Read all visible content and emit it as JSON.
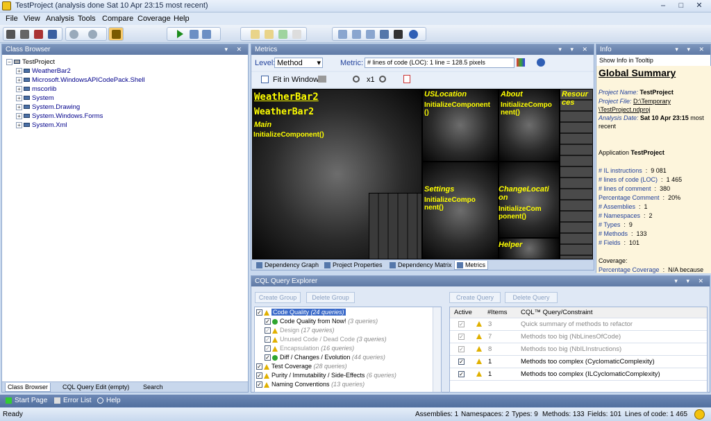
{
  "window": {
    "title": "TestProject  (analysis done Sat 10 Apr  23:15 most recent)",
    "minimize": "–",
    "maximize": "□",
    "close": "✕"
  },
  "menu": [
    "File",
    "View",
    "Analysis",
    "Tools",
    "Compare",
    "Coverage",
    "Help"
  ],
  "class_browser": {
    "title": "Class Browser",
    "root": "TestProject",
    "items": [
      "WeatherBar2",
      "Microsoft.WindowsAPICodePack.Shell",
      "mscorlib",
      "System",
      "System.Drawing",
      "System.Windows.Forms",
      "System.Xml"
    ],
    "tabs": [
      "Class Browser",
      "CQL Query Edit (empty)",
      "Search"
    ]
  },
  "metrics": {
    "title": "Metrics",
    "level_label": "Level:",
    "level_value": "Method",
    "metric_label": "Metric:",
    "metric_value": "# lines of code (LOC):  1 line = 128.5 pixels",
    "fit_label": "Fit in Window",
    "zoom_label": "x1",
    "labels": {
      "weatherbar_a": "WeatherBar2",
      "weatherbar_b": "WeatherBar2",
      "main": "Main",
      "main_m": "InitializeComponent()",
      "uslocation": "USLocation",
      "uslocation_m": "InitializeComponent ()",
      "about": "About",
      "about_m": "InitializeCompo nent()",
      "resources": "Resour ces",
      "settings": "Settings",
      "settings_m": "InitializeCompo nent()",
      "changeloc": "ChangeLocati on",
      "changeloc_m": "InitializeCom ponent()",
      "helper": "Helper"
    },
    "tabs": [
      "Dependency Graph",
      "Project Properties",
      "Dependency Matrix",
      "Metrics"
    ]
  },
  "info": {
    "title": "Info",
    "tooltip_label": "Show Info in Tooltip",
    "heading": "Global Summary",
    "project_name_label": "Project Name:",
    "project_name": "TestProject",
    "project_file_label": "Project File:",
    "project_file_1": "D:\\Temporary",
    "project_file_2": "\\TestProject.ndproj",
    "analysis_date_label": "Analysis Date:",
    "analysis_date": "Sat 10 Apr  23:15",
    "analysis_date_suffix": "most",
    "analysis_date_suffix2": "recent",
    "application_label": "Application",
    "application_name": "TestProject",
    "stats": [
      {
        "label": "# IL instructions",
        "value": "9 081"
      },
      {
        "label": "# lines of code (LOC)",
        "value": "1 465"
      },
      {
        "label": "# lines of comment",
        "value": "380"
      },
      {
        "label": "Percentage Comment",
        "value": "20%"
      },
      {
        "label": "# Assemblies",
        "value": "1"
      },
      {
        "label": "# Namespaces",
        "value": "2"
      },
      {
        "label": "# Types",
        "value": "9"
      },
      {
        "label": "# Methods",
        "value": "133"
      },
      {
        "label": "# Fields",
        "value": "101"
      }
    ],
    "coverage_label": "Coverage:",
    "coverage_line": "Percentage Coverage",
    "coverage_value": "N/A because"
  },
  "cql": {
    "title": "CQL Query Explorer",
    "buttons": {
      "create_group": "Create Group",
      "delete_group": "Delete Group",
      "create_query": "Create Query",
      "delete_query": "Delete Query"
    },
    "groups": [
      {
        "name": "Code Quality",
        "count": "(24 queries)"
      },
      {
        "name": "Code Quality from Now!",
        "count": "(3 queries)"
      },
      {
        "name": "Design",
        "count": "(17 queries)"
      },
      {
        "name": "Unused Code / Dead Code",
        "count": "(3 queries)"
      },
      {
        "name": "Encapsulation",
        "count": "(16 queries)"
      },
      {
        "name": "Diff / Changes / Evolution",
        "count": "(44 queries)"
      },
      {
        "name": "Test Coverage",
        "count": "(28 queries)"
      },
      {
        "name": "Purity / Immutability / Side-Effects",
        "count": "(6 queries)"
      },
      {
        "name": "Naming Conventions",
        "count": "(13 queries)"
      }
    ],
    "grid_headers": [
      "Active",
      "#Items",
      "CQL™ Query/Constraint"
    ],
    "rows": [
      {
        "items": "3",
        "query": "Quick summary of methods to refactor"
      },
      {
        "items": "7",
        "query": "Methods too big (NbLinesOfCode)"
      },
      {
        "items": "8",
        "query": "Methods too big (NbILInstructions)"
      },
      {
        "items": "1",
        "query": "Methods too complex (CyclomaticComplexity)"
      },
      {
        "items": "1",
        "query": "Methods too complex (ILCyclomaticComplexity)"
      }
    ]
  },
  "bottom_nav": [
    "Start Page",
    "Error List",
    "Help"
  ],
  "status": {
    "ready": "Ready",
    "assemblies": "Assemblies: 1",
    "namespaces": "Namespaces: 2",
    "types": "Types: 9",
    "methods": "Methods: 133",
    "fields": "Fields: 101",
    "loc": "Lines of code: 1 465"
  }
}
